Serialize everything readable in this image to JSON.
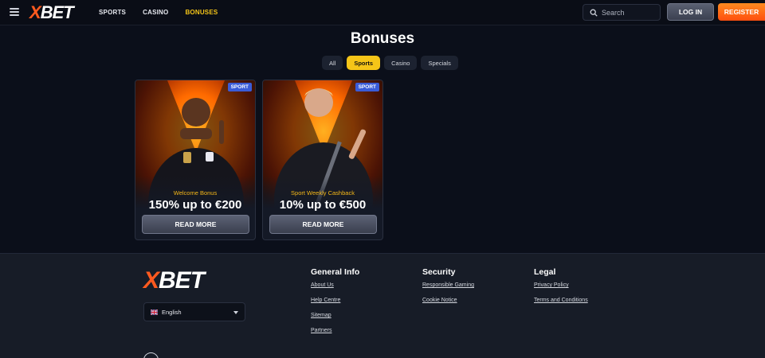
{
  "header": {
    "logo": {
      "x": "X",
      "rest": "BET"
    },
    "nav": [
      "SPORTS",
      "CASINO",
      "BONUSES"
    ],
    "active_nav": "BONUSES",
    "search_placeholder": "Search",
    "login_label": "LOG IN",
    "register_label": "REGISTER"
  },
  "main": {
    "title": "Bonuses",
    "tabs": [
      "All",
      "Sports",
      "Casino",
      "Specials"
    ],
    "active_tab": "Sports",
    "cards": [
      {
        "badge": "SPORT",
        "subtitle": "Welcome Bonus",
        "offer": "150% up to €200",
        "button": "READ MORE"
      },
      {
        "badge": "SPORT",
        "subtitle": "Sport Weekly Cashback",
        "offer": "10% up to €500",
        "button": "READ MORE"
      }
    ]
  },
  "footer": {
    "logo": {
      "x": "X",
      "rest": "BET"
    },
    "language": "English",
    "columns": [
      {
        "title": "General Info",
        "links": [
          "About Us",
          "Help Centre",
          "Sitemap",
          "Partners"
        ]
      },
      {
        "title": "Security",
        "links": [
          "Responsible Gaming",
          "Cookie Notice"
        ]
      },
      {
        "title": "Legal",
        "links": [
          "Privacy Policy",
          "Terms and Conditions"
        ]
      }
    ]
  },
  "colors": {
    "accent": "#f5c518",
    "brand": "#ff5a1f",
    "badge": "#3a5cd8"
  }
}
